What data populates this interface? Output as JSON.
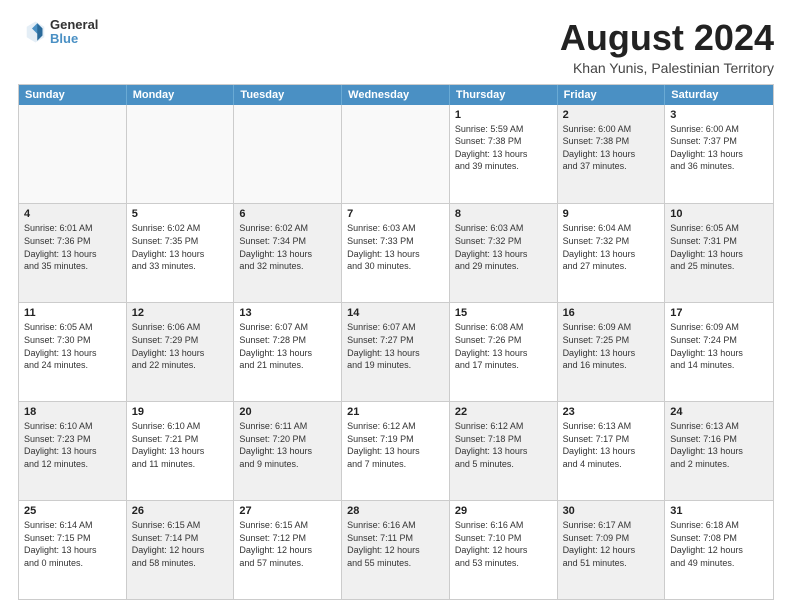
{
  "header": {
    "logo_general": "General",
    "logo_blue": "Blue",
    "month_title": "August 2024",
    "location": "Khan Yunis, Palestinian Territory"
  },
  "weekdays": [
    "Sunday",
    "Monday",
    "Tuesday",
    "Wednesday",
    "Thursday",
    "Friday",
    "Saturday"
  ],
  "weeks": [
    [
      {
        "day": "",
        "lines": [],
        "empty": true
      },
      {
        "day": "",
        "lines": [],
        "empty": true
      },
      {
        "day": "",
        "lines": [],
        "empty": true
      },
      {
        "day": "",
        "lines": [],
        "empty": true
      },
      {
        "day": "1",
        "lines": [
          "Sunrise: 5:59 AM",
          "Sunset: 7:38 PM",
          "Daylight: 13 hours",
          "and 39 minutes."
        ],
        "shaded": false
      },
      {
        "day": "2",
        "lines": [
          "Sunrise: 6:00 AM",
          "Sunset: 7:38 PM",
          "Daylight: 13 hours",
          "and 37 minutes."
        ],
        "shaded": true
      },
      {
        "day": "3",
        "lines": [
          "Sunrise: 6:00 AM",
          "Sunset: 7:37 PM",
          "Daylight: 13 hours",
          "and 36 minutes."
        ],
        "shaded": false
      }
    ],
    [
      {
        "day": "4",
        "lines": [
          "Sunrise: 6:01 AM",
          "Sunset: 7:36 PM",
          "Daylight: 13 hours",
          "and 35 minutes."
        ],
        "shaded": true
      },
      {
        "day": "5",
        "lines": [
          "Sunrise: 6:02 AM",
          "Sunset: 7:35 PM",
          "Daylight: 13 hours",
          "and 33 minutes."
        ],
        "shaded": false
      },
      {
        "day": "6",
        "lines": [
          "Sunrise: 6:02 AM",
          "Sunset: 7:34 PM",
          "Daylight: 13 hours",
          "and 32 minutes."
        ],
        "shaded": true
      },
      {
        "day": "7",
        "lines": [
          "Sunrise: 6:03 AM",
          "Sunset: 7:33 PM",
          "Daylight: 13 hours",
          "and 30 minutes."
        ],
        "shaded": false
      },
      {
        "day": "8",
        "lines": [
          "Sunrise: 6:03 AM",
          "Sunset: 7:32 PM",
          "Daylight: 13 hours",
          "and 29 minutes."
        ],
        "shaded": true
      },
      {
        "day": "9",
        "lines": [
          "Sunrise: 6:04 AM",
          "Sunset: 7:32 PM",
          "Daylight: 13 hours",
          "and 27 minutes."
        ],
        "shaded": false
      },
      {
        "day": "10",
        "lines": [
          "Sunrise: 6:05 AM",
          "Sunset: 7:31 PM",
          "Daylight: 13 hours",
          "and 25 minutes."
        ],
        "shaded": true
      }
    ],
    [
      {
        "day": "11",
        "lines": [
          "Sunrise: 6:05 AM",
          "Sunset: 7:30 PM",
          "Daylight: 13 hours",
          "and 24 minutes."
        ],
        "shaded": false
      },
      {
        "day": "12",
        "lines": [
          "Sunrise: 6:06 AM",
          "Sunset: 7:29 PM",
          "Daylight: 13 hours",
          "and 22 minutes."
        ],
        "shaded": true
      },
      {
        "day": "13",
        "lines": [
          "Sunrise: 6:07 AM",
          "Sunset: 7:28 PM",
          "Daylight: 13 hours",
          "and 21 minutes."
        ],
        "shaded": false
      },
      {
        "day": "14",
        "lines": [
          "Sunrise: 6:07 AM",
          "Sunset: 7:27 PM",
          "Daylight: 13 hours",
          "and 19 minutes."
        ],
        "shaded": true
      },
      {
        "day": "15",
        "lines": [
          "Sunrise: 6:08 AM",
          "Sunset: 7:26 PM",
          "Daylight: 13 hours",
          "and 17 minutes."
        ],
        "shaded": false
      },
      {
        "day": "16",
        "lines": [
          "Sunrise: 6:09 AM",
          "Sunset: 7:25 PM",
          "Daylight: 13 hours",
          "and 16 minutes."
        ],
        "shaded": true
      },
      {
        "day": "17",
        "lines": [
          "Sunrise: 6:09 AM",
          "Sunset: 7:24 PM",
          "Daylight: 13 hours",
          "and 14 minutes."
        ],
        "shaded": false
      }
    ],
    [
      {
        "day": "18",
        "lines": [
          "Sunrise: 6:10 AM",
          "Sunset: 7:23 PM",
          "Daylight: 13 hours",
          "and 12 minutes."
        ],
        "shaded": true
      },
      {
        "day": "19",
        "lines": [
          "Sunrise: 6:10 AM",
          "Sunset: 7:21 PM",
          "Daylight: 13 hours",
          "and 11 minutes."
        ],
        "shaded": false
      },
      {
        "day": "20",
        "lines": [
          "Sunrise: 6:11 AM",
          "Sunset: 7:20 PM",
          "Daylight: 13 hours",
          "and 9 minutes."
        ],
        "shaded": true
      },
      {
        "day": "21",
        "lines": [
          "Sunrise: 6:12 AM",
          "Sunset: 7:19 PM",
          "Daylight: 13 hours",
          "and 7 minutes."
        ],
        "shaded": false
      },
      {
        "day": "22",
        "lines": [
          "Sunrise: 6:12 AM",
          "Sunset: 7:18 PM",
          "Daylight: 13 hours",
          "and 5 minutes."
        ],
        "shaded": true
      },
      {
        "day": "23",
        "lines": [
          "Sunrise: 6:13 AM",
          "Sunset: 7:17 PM",
          "Daylight: 13 hours",
          "and 4 minutes."
        ],
        "shaded": false
      },
      {
        "day": "24",
        "lines": [
          "Sunrise: 6:13 AM",
          "Sunset: 7:16 PM",
          "Daylight: 13 hours",
          "and 2 minutes."
        ],
        "shaded": true
      }
    ],
    [
      {
        "day": "25",
        "lines": [
          "Sunrise: 6:14 AM",
          "Sunset: 7:15 PM",
          "Daylight: 13 hours",
          "and 0 minutes."
        ],
        "shaded": false
      },
      {
        "day": "26",
        "lines": [
          "Sunrise: 6:15 AM",
          "Sunset: 7:14 PM",
          "Daylight: 12 hours",
          "and 58 minutes."
        ],
        "shaded": true
      },
      {
        "day": "27",
        "lines": [
          "Sunrise: 6:15 AM",
          "Sunset: 7:12 PM",
          "Daylight: 12 hours",
          "and 57 minutes."
        ],
        "shaded": false
      },
      {
        "day": "28",
        "lines": [
          "Sunrise: 6:16 AM",
          "Sunset: 7:11 PM",
          "Daylight: 12 hours",
          "and 55 minutes."
        ],
        "shaded": true
      },
      {
        "day": "29",
        "lines": [
          "Sunrise: 6:16 AM",
          "Sunset: 7:10 PM",
          "Daylight: 12 hours",
          "and 53 minutes."
        ],
        "shaded": false
      },
      {
        "day": "30",
        "lines": [
          "Sunrise: 6:17 AM",
          "Sunset: 7:09 PM",
          "Daylight: 12 hours",
          "and 51 minutes."
        ],
        "shaded": true
      },
      {
        "day": "31",
        "lines": [
          "Sunrise: 6:18 AM",
          "Sunset: 7:08 PM",
          "Daylight: 12 hours",
          "and 49 minutes."
        ],
        "shaded": false
      }
    ]
  ]
}
